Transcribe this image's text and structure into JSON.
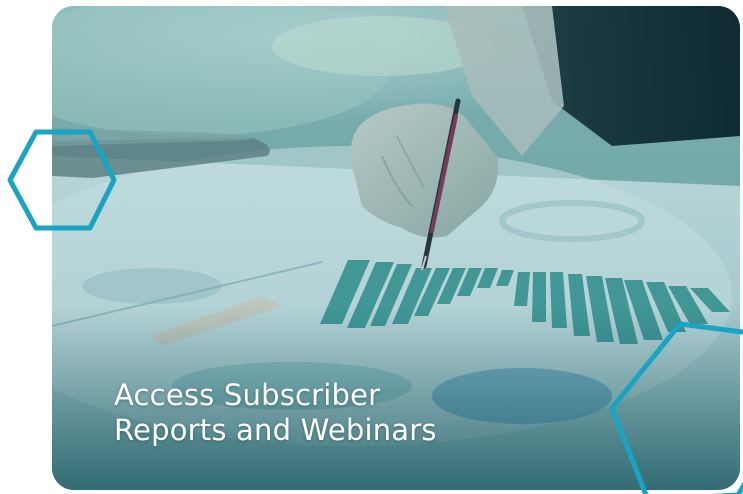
{
  "card": {
    "headline_line1": "Access Subscriber",
    "headline_line2": "Reports and Webinars"
  },
  "decorations": {
    "hex_color": "#1aa3c2",
    "icons": [
      "hexagon-outline-icon",
      "hexagon-outline-icon"
    ]
  }
}
